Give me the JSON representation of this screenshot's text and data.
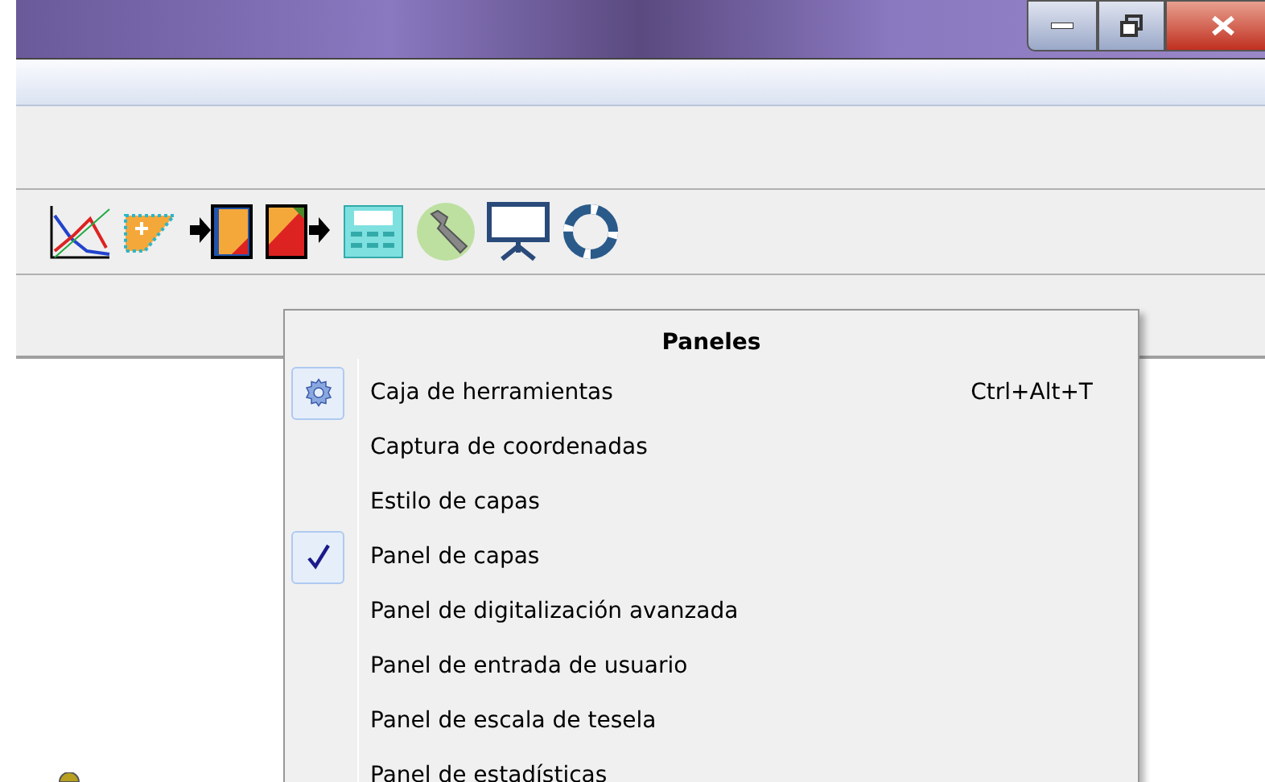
{
  "menu": {
    "title": "Paneles",
    "items": [
      {
        "kind": "gear",
        "label": "Caja de herramientas",
        "shortcut": "Ctrl+Alt+T"
      },
      {
        "kind": "toggle",
        "label": "Captura de coordenadas",
        "checked": false
      },
      {
        "kind": "toggle",
        "label": "Estilo de capas",
        "checked": false
      },
      {
        "kind": "toggle",
        "label": "Panel de capas",
        "checked": true
      },
      {
        "kind": "toggle",
        "label": "Panel de digitalización avanzada",
        "checked": false
      },
      {
        "kind": "toggle",
        "label": "Panel de entrada de usuario",
        "checked": false
      },
      {
        "kind": "toggle",
        "label": "Panel de escala de tesela",
        "checked": false
      },
      {
        "kind": "toggle",
        "label": "Panel de estadísticas",
        "checked": false
      }
    ]
  }
}
